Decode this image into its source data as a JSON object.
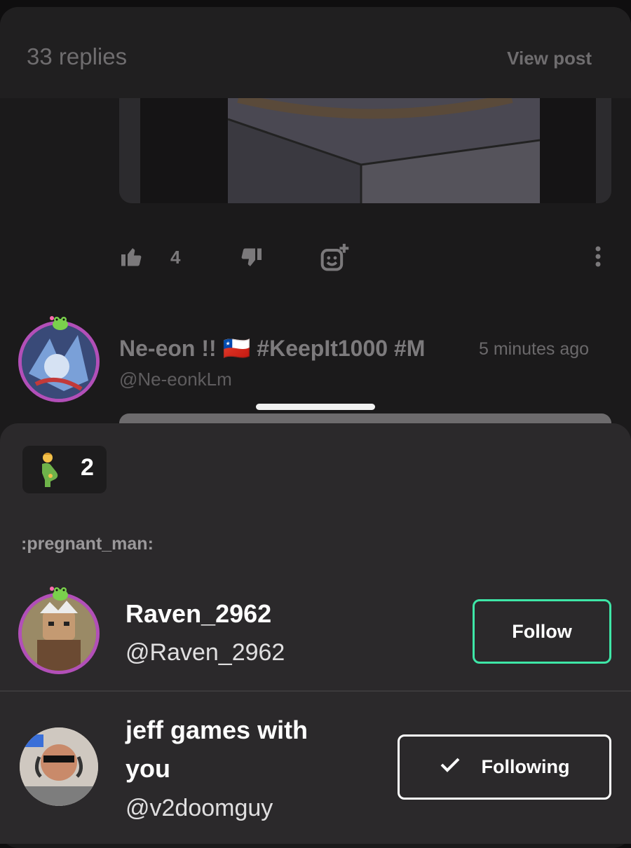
{
  "header": {
    "replies_label": "33 replies",
    "view_post_label": "View post"
  },
  "post": {
    "like_count": "4"
  },
  "comment": {
    "name": "Ne-eon !! 🇨🇱 #KeepIt1000 #M",
    "time": "5 minutes ago",
    "handle": "@Ne-eonkLm"
  },
  "reaction_sheet": {
    "chip_emoji": "pregnant-man-emoji",
    "chip_count": "2",
    "emoji_name": ":pregnant_man:",
    "users": [
      {
        "name": "Raven_2962",
        "handle": "@Raven_2962",
        "button_label": "Follow"
      },
      {
        "name": "jeff games with you",
        "handle": "@v2doomguy",
        "button_label": "Following"
      }
    ]
  },
  "colors": {
    "accent_follow": "#3ee6a7",
    "avatar_ring": "#b24fb8"
  }
}
